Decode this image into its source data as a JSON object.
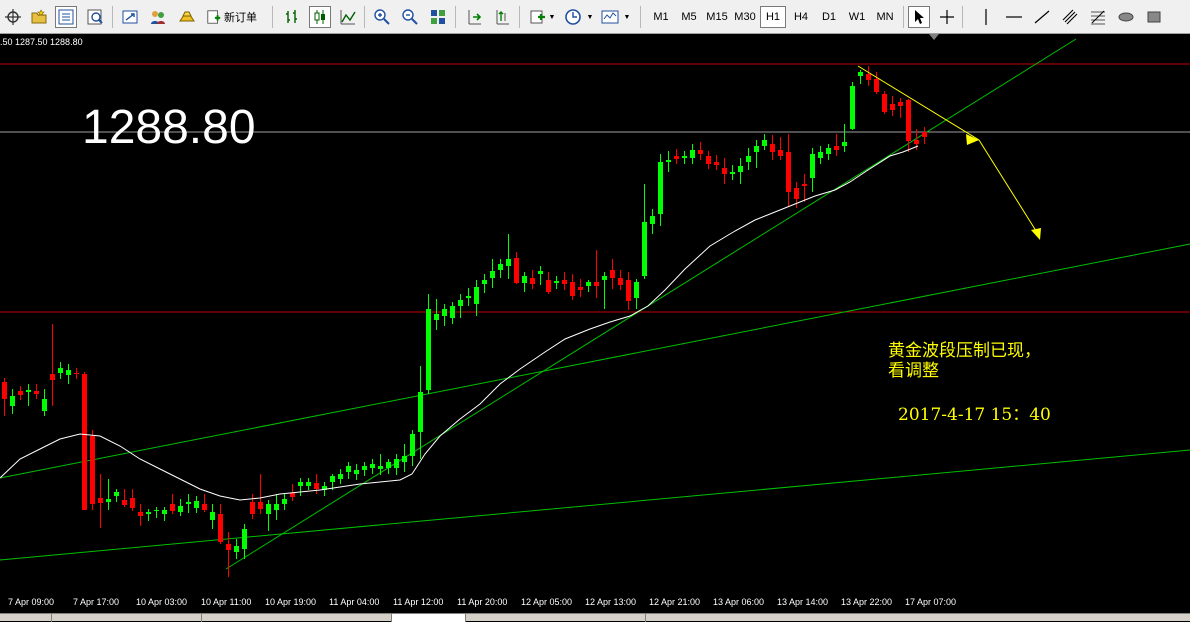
{
  "toolbar": {
    "new_order_label": "新订单",
    "timeframes": [
      "M1",
      "M5",
      "M15",
      "M30",
      "H1",
      "H4",
      "D1",
      "W1",
      "MN"
    ],
    "active_timeframe": "H1"
  },
  "chart": {
    "ohlc_readout": ".50 1287.50 1288.80",
    "current_price": "1288.80",
    "note_line1": "黄金波段压制已现，",
    "note_line2": "看调整",
    "note_date": "2017-4-17  15：40",
    "x_labels": [
      "7 Apr 09:00",
      "7 Apr 17:00",
      "10 Apr 03:00",
      "10 Apr 11:00",
      "10 Apr 19:00",
      "11 Apr 04:00",
      "11 Apr 12:00",
      "11 Apr 20:00",
      "12 Apr 05:00",
      "12 Apr 13:00",
      "12 Apr 21:00",
      "13 Apr 06:00",
      "13 Apr 14:00",
      "13 Apr 22:00",
      "17 Apr 07:00"
    ]
  },
  "colors": {
    "background": "#000000",
    "bull_candle": "#00ff00",
    "bear_candle": "#ff0000",
    "moving_average": "#ffffff",
    "trendline": "#00c000",
    "horizontal_line": "#c00000",
    "price_line": "#a0a0a0",
    "arrow": "#ffff00"
  }
}
